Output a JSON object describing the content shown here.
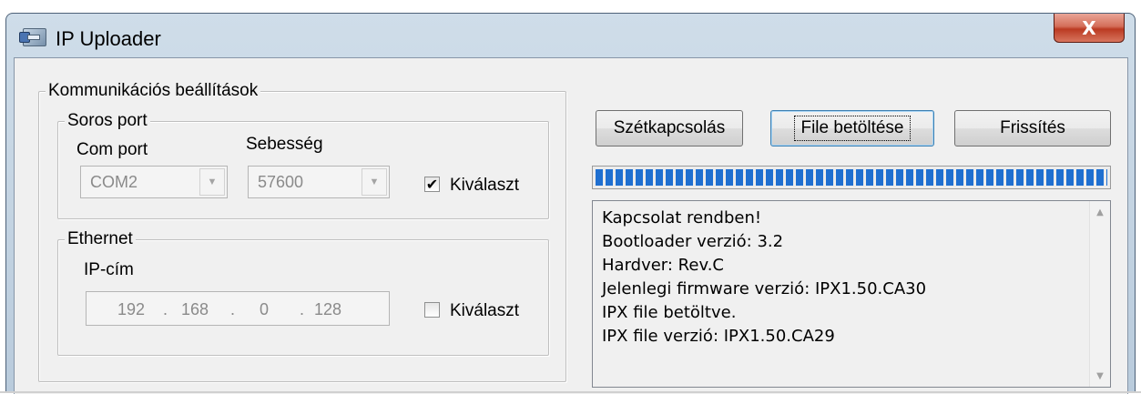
{
  "window": {
    "title": "IP Uploader",
    "close_label": "X"
  },
  "communication": {
    "group_title": "Kommunikációs beállítások",
    "serial": {
      "group_title": "Soros port",
      "com_port_label": "Com port",
      "com_port_value": "COM2",
      "speed_label": "Sebesség",
      "speed_value": "57600",
      "select_label": "Kiválaszt",
      "select_checked": true,
      "check_glyph": "✔"
    },
    "ethernet": {
      "group_title": "Ethernet",
      "ip_label": "IP-cím",
      "ip_octets": [
        "192",
        "168",
        "0",
        "128"
      ],
      "ip_dot": ".",
      "select_label": "Kiválaszt",
      "select_checked": false
    }
  },
  "toolbar": {
    "disconnect_label": "Szétkapcsolás",
    "load_file_label": "File betöltése",
    "refresh_label": "Frissítés"
  },
  "progress": {
    "percent": 100,
    "color": "#1f6fd0"
  },
  "log": {
    "lines": [
      "Kapcsolat rendben!",
      "Bootloader verzió: 3.2",
      "Hardver: Rev.C",
      "Jelenlegi firmware verzió: IPX1.50.CA30",
      "IPX file betöltve.",
      "IPX file verzió: IPX1.50.CA29"
    ]
  },
  "icons": {
    "app": "app-window-icon",
    "dropdown": "chevron-down-icon",
    "scroll_up": "scroll-up-arrow-icon",
    "scroll_down": "scroll-down-arrow-icon"
  }
}
